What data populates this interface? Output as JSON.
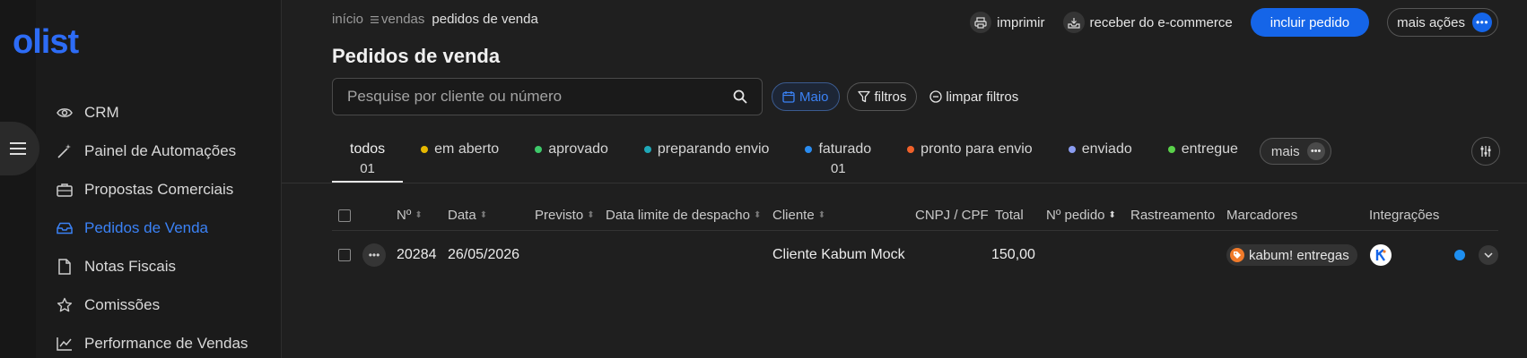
{
  "brand": {
    "logo_text": "olist",
    "color": "#2d6cf6"
  },
  "sidebar": {
    "items": [
      {
        "label": "CRM",
        "icon": "eye-icon"
      },
      {
        "label": "Painel de Automações",
        "icon": "magic-wand-icon"
      },
      {
        "label": "Propostas Comerciais",
        "icon": "briefcase-icon"
      },
      {
        "label": "Pedidos de Venda",
        "icon": "inbox-icon",
        "active": true
      },
      {
        "label": "Notas Fiscais",
        "icon": "document-icon"
      },
      {
        "label": "Comissões",
        "icon": "star-icon"
      },
      {
        "label": "Performance de Vendas",
        "icon": "line-chart-icon"
      }
    ]
  },
  "breadcrumb": {
    "home": "início",
    "section": "vendas",
    "current": "pedidos de venda"
  },
  "page_title": "Pedidos de venda",
  "actions": {
    "print": "imprimir",
    "receive_ecommerce": "receber do e-commerce",
    "add_order": "incluir pedido",
    "more_actions": "mais ações"
  },
  "search": {
    "placeholder": "Pesquise por cliente ou número",
    "value": ""
  },
  "filters": {
    "month": "Maio",
    "filters": "filtros",
    "clear": "limpar filtros"
  },
  "status_tabs": [
    {
      "label": "todos",
      "count": "01",
      "active": true
    },
    {
      "label": "em aberto",
      "color": "#e6b800"
    },
    {
      "label": "aprovado",
      "color": "#3ec96a"
    },
    {
      "label": "preparando envio",
      "color": "#1fa8b8"
    },
    {
      "label": "faturado",
      "color": "#2a8cf0",
      "count": "01"
    },
    {
      "label": "pronto para envio",
      "color": "#f0612a"
    },
    {
      "label": "enviado",
      "color": "#8a9cf0"
    },
    {
      "label": "entregue",
      "color": "#5ad14a"
    }
  ],
  "more_tab": "mais",
  "table": {
    "headers": {
      "number": "Nº",
      "date": "Data",
      "expected": "Previsto",
      "dispatch_limit": "Data limite de despacho",
      "customer": "Cliente",
      "tax_id": "CNPJ / CPF",
      "total": "Total",
      "order_number": "Nº pedido",
      "tracking": "Rastreamento",
      "markers": "Marcadores",
      "integrations": "Integrações"
    },
    "rows": [
      {
        "number": "20284",
        "date": "26/05/2026",
        "expected": "",
        "dispatch_limit": "",
        "customer": "Cliente Kabum Mock",
        "tax_id": "",
        "total": "150,00",
        "order_number": "",
        "tracking": "",
        "marker": "kabum! entregas",
        "integration_icon": "kabum-logo-icon",
        "status_color": "#1e8ff0"
      }
    ]
  }
}
